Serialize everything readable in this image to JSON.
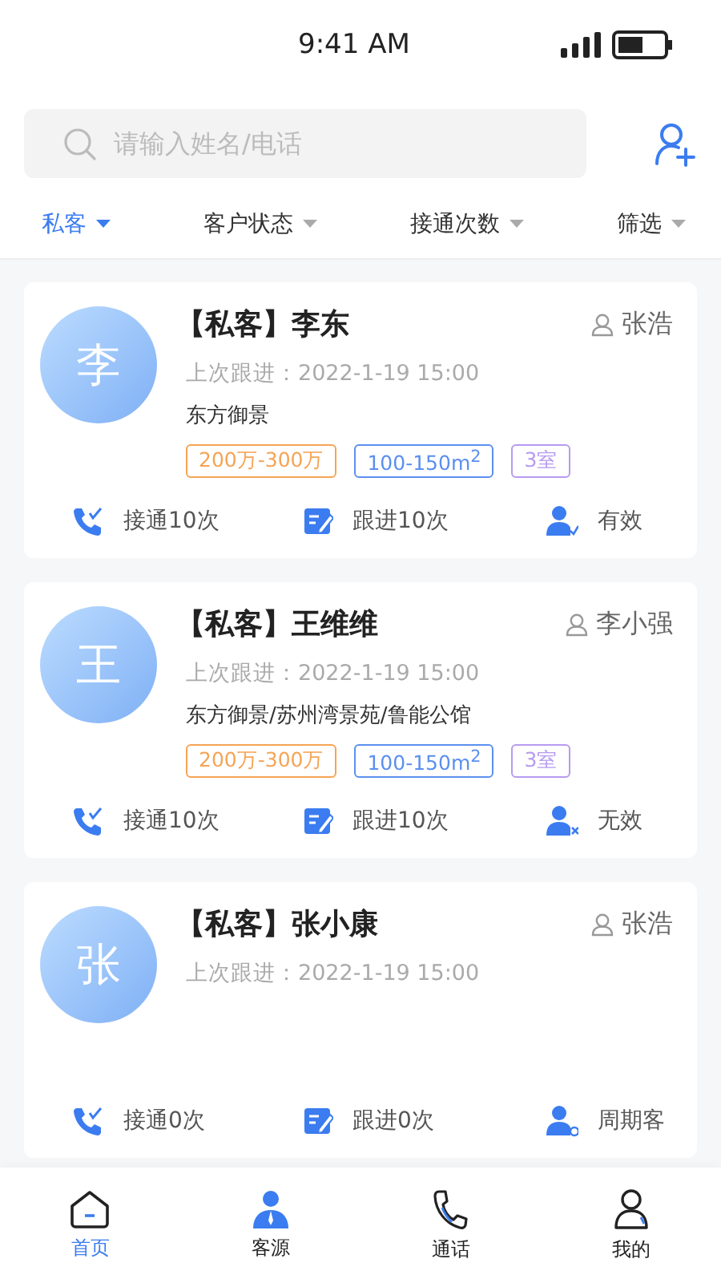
{
  "status_bar": {
    "time": "9:41 AM"
  },
  "search": {
    "placeholder": "请输入姓名/电话"
  },
  "filters": [
    {
      "label": "私客",
      "selected": true
    },
    {
      "label": "客户状态",
      "selected": false
    },
    {
      "label": "接通次数",
      "selected": false
    },
    {
      "label": "筛选",
      "selected": false
    }
  ],
  "customers": [
    {
      "avatar": "李",
      "name": "【私客】李东",
      "owner": "张浩",
      "last_follow": "上次跟进：2022-1-19  15:00",
      "address": "东方御景",
      "tags": [
        {
          "text": "200万-300万",
          "color": "#f5a455"
        },
        {
          "text": "100-150m$^{2}$",
          "color": "#5b8ff0"
        },
        {
          "text": "3室",
          "color": "#b79af0"
        }
      ],
      "connected": "接通10次",
      "followups": "跟进10次",
      "status": {
        "kind": "valid",
        "text": "有效"
      }
    },
    {
      "avatar": "王",
      "name": "【私客】王维维",
      "owner": "李小强",
      "last_follow": "上次跟进：2022-1-19  15:00",
      "address": "东方御景/苏州湾景苑/鲁能公馆",
      "tags": [
        {
          "text": "200万-300万",
          "color": "#f5a455"
        },
        {
          "text": "100-150m$^{2}$",
          "color": "#5b8ff0"
        },
        {
          "text": "3室",
          "color": "#b79af0"
        }
      ],
      "connected": "接通10次",
      "followups": "跟进10次",
      "status": {
        "kind": "invalid",
        "text": "无效"
      }
    },
    {
      "avatar": "张",
      "name": "【私客】张小康",
      "owner": "张浩",
      "last_follow": "上次跟进：2022-1-19  15:00",
      "connected": "接通0次",
      "followups": "跟进0次",
      "status": {
        "kind": "cycle",
        "text": "周期客"
      }
    }
  ],
  "nav": [
    {
      "kind": "home",
      "label": "首页",
      "selected": true
    },
    {
      "kind": "clients",
      "label": "客源",
      "selected": false
    },
    {
      "kind": "calls",
      "label": "通话",
      "selected": false
    },
    {
      "kind": "mine",
      "label": "我的",
      "selected": false
    }
  ]
}
